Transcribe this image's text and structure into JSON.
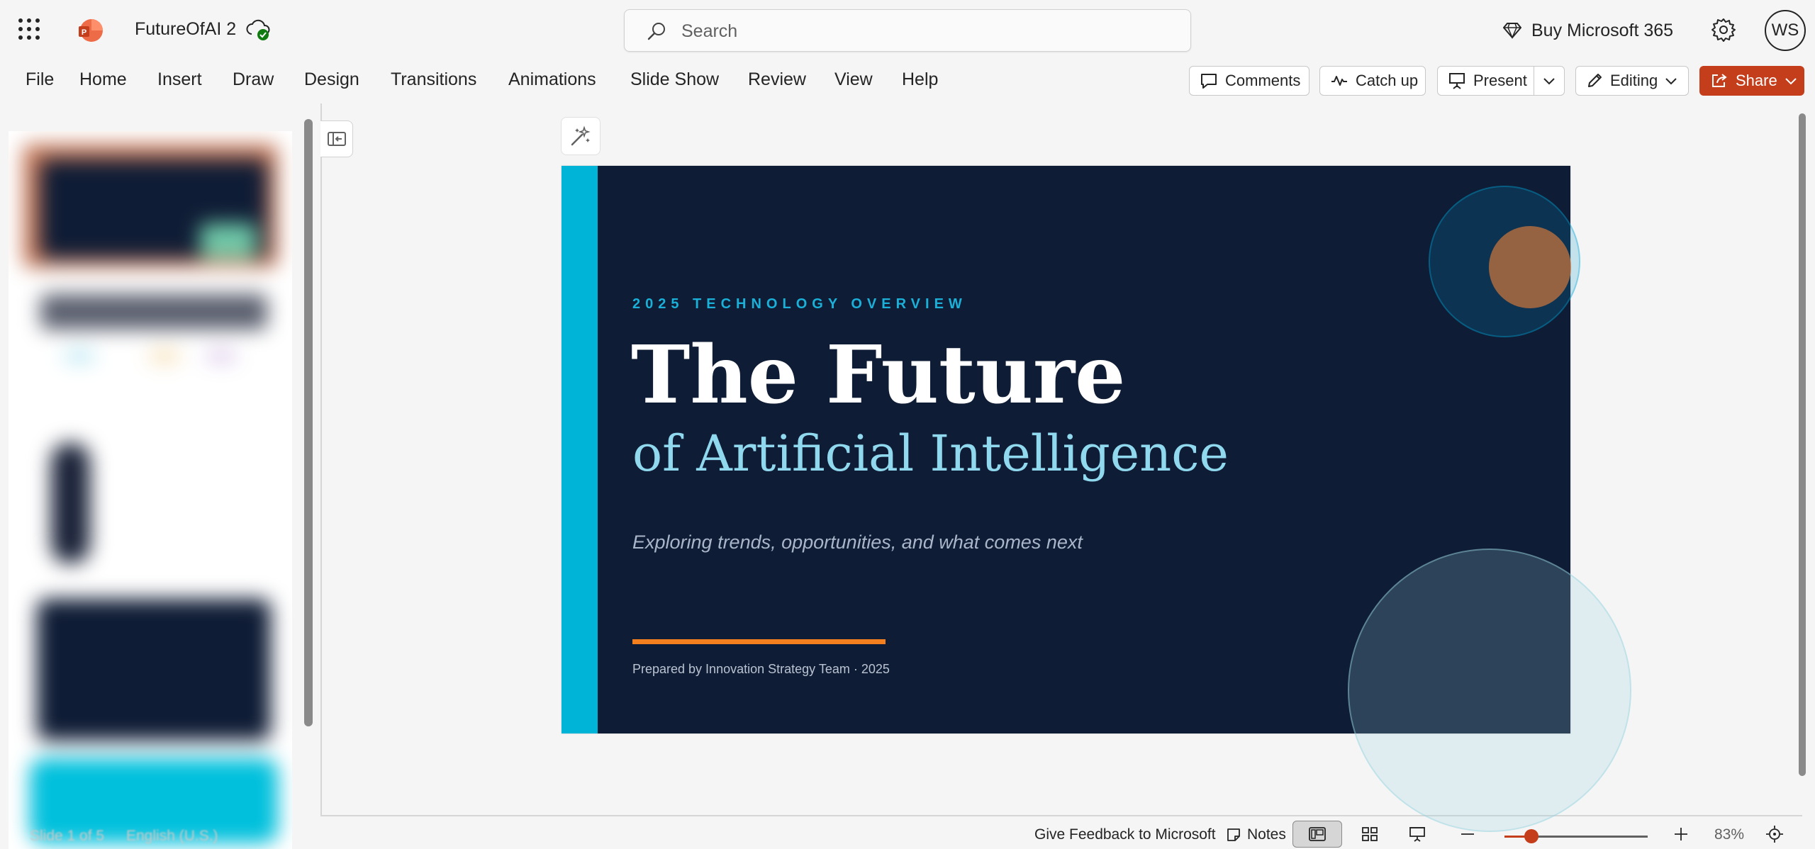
{
  "app": {
    "doc_title": "FutureOfAI 2",
    "search_placeholder": "Search",
    "buy_label": "Buy Microsoft 365",
    "user_initials": "WS"
  },
  "ribbon": {
    "tabs": [
      "File",
      "Home",
      "Insert",
      "Draw",
      "Design",
      "Transitions",
      "Animations",
      "Slide Show",
      "Review",
      "View",
      "Help"
    ],
    "comments_label": "Comments",
    "catchup_label": "Catch up",
    "present_label": "Present",
    "editing_label": "Editing",
    "share_label": "Share"
  },
  "slide": {
    "eyebrow": "2025 TECHNOLOGY OVERVIEW",
    "title": "The Future",
    "subtitle": "of Artificial Intelligence",
    "tagline": "Exploring trends, opportunities, and what comes next",
    "credit": "Prepared by Innovation Strategy Team  ·  2025"
  },
  "status": {
    "slide_position": "Slide 1 of 5",
    "language": "English (U.S.)",
    "feedback": "Give Feedback to Microsoft",
    "notes": "Notes",
    "zoom": "83%",
    "zoom_level": 0.19
  },
  "colors": {
    "accent": "#c43e1c",
    "slide_bg": "#0f1c35",
    "slide_bar": "#00b4d8",
    "slide_rule": "#f37f1e"
  }
}
